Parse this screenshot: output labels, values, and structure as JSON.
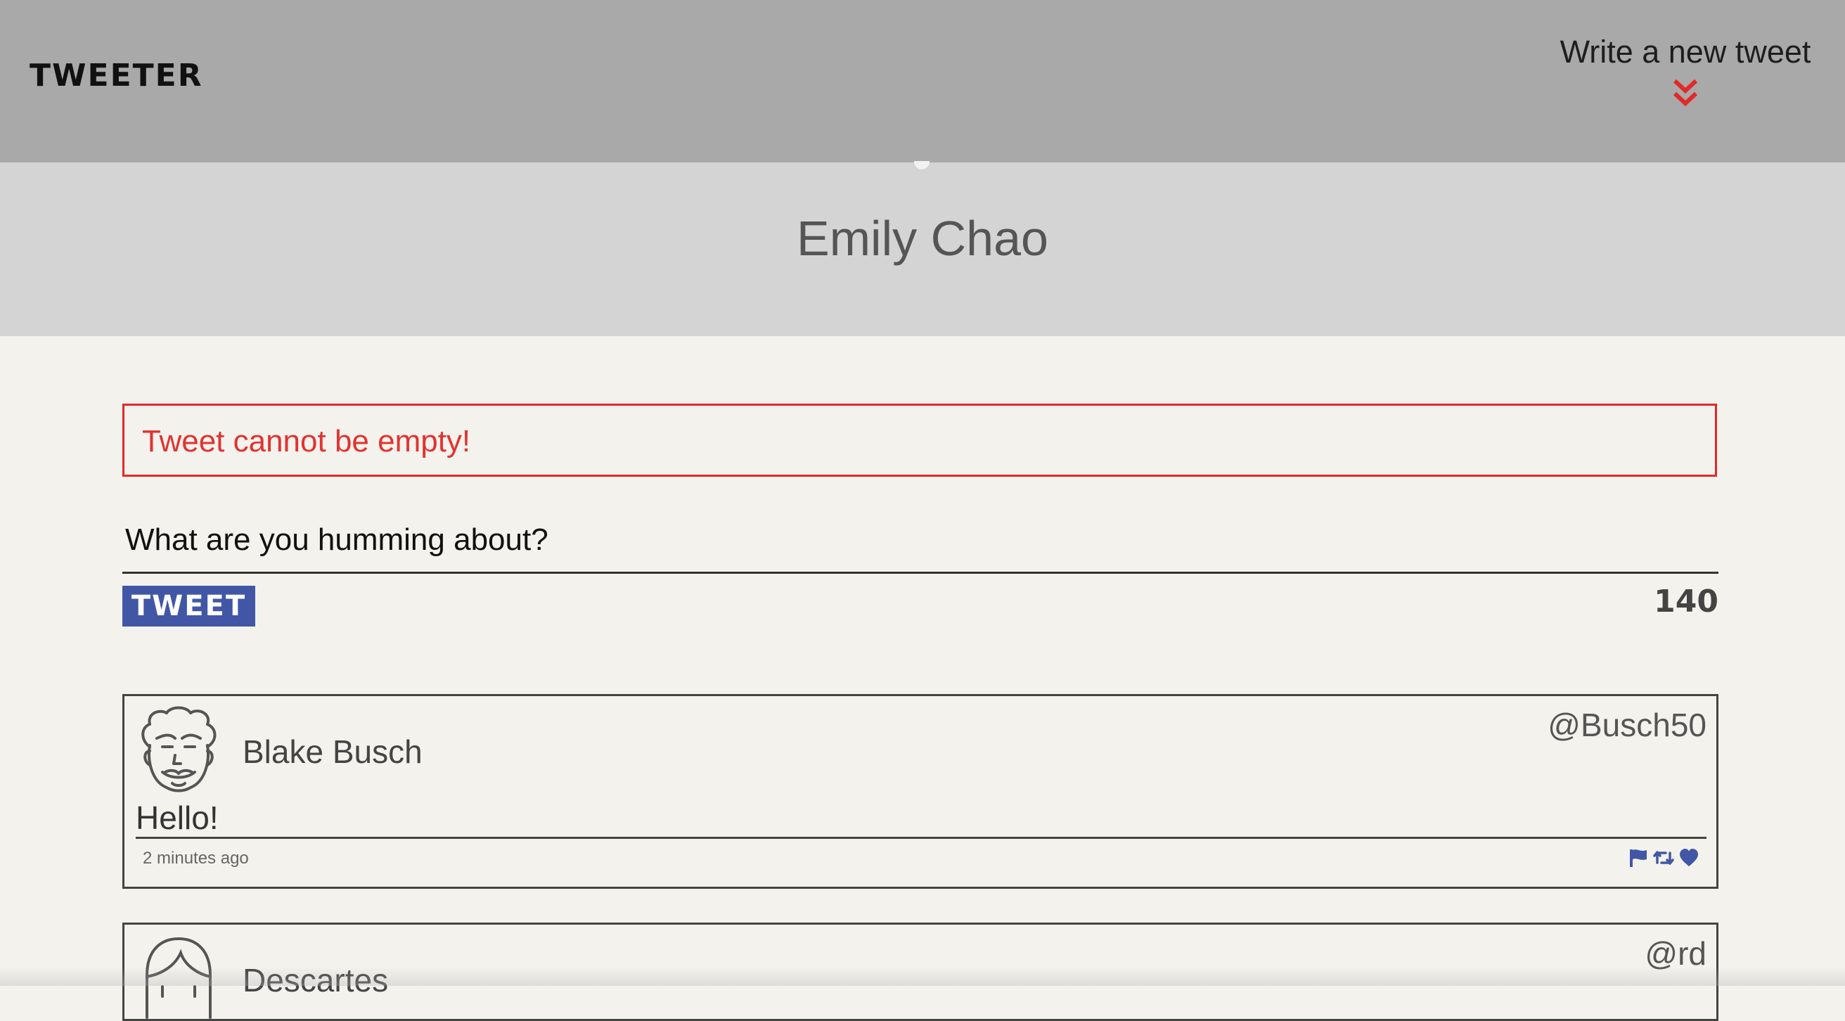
{
  "nav": {
    "brand": "TWEETER",
    "compose_label": "Write a new tweet",
    "compose_icon": "chevron-double-down-icon",
    "accent_color": "#e02a27",
    "background_color": "#a9a9a9"
  },
  "profile": {
    "name": "Emily Chao"
  },
  "compose": {
    "error_text": "Tweet cannot be empty!",
    "placeholder": "What are you humming about?",
    "button_label": "TWEET",
    "button_color": "#4157a6",
    "char_counter": "140"
  },
  "tweets": [
    {
      "name": "Blake Busch",
      "handle": "@Busch50",
      "content": "Hello!",
      "timestamp": "2 minutes ago",
      "avatar_icon": "curly-hair-avatar-icon",
      "actions": [
        "flag-icon",
        "retweet-icon",
        "heart-icon"
      ]
    },
    {
      "name": "Descartes",
      "handle": "@rd",
      "avatar_icon": "long-hair-avatar-icon"
    }
  ]
}
